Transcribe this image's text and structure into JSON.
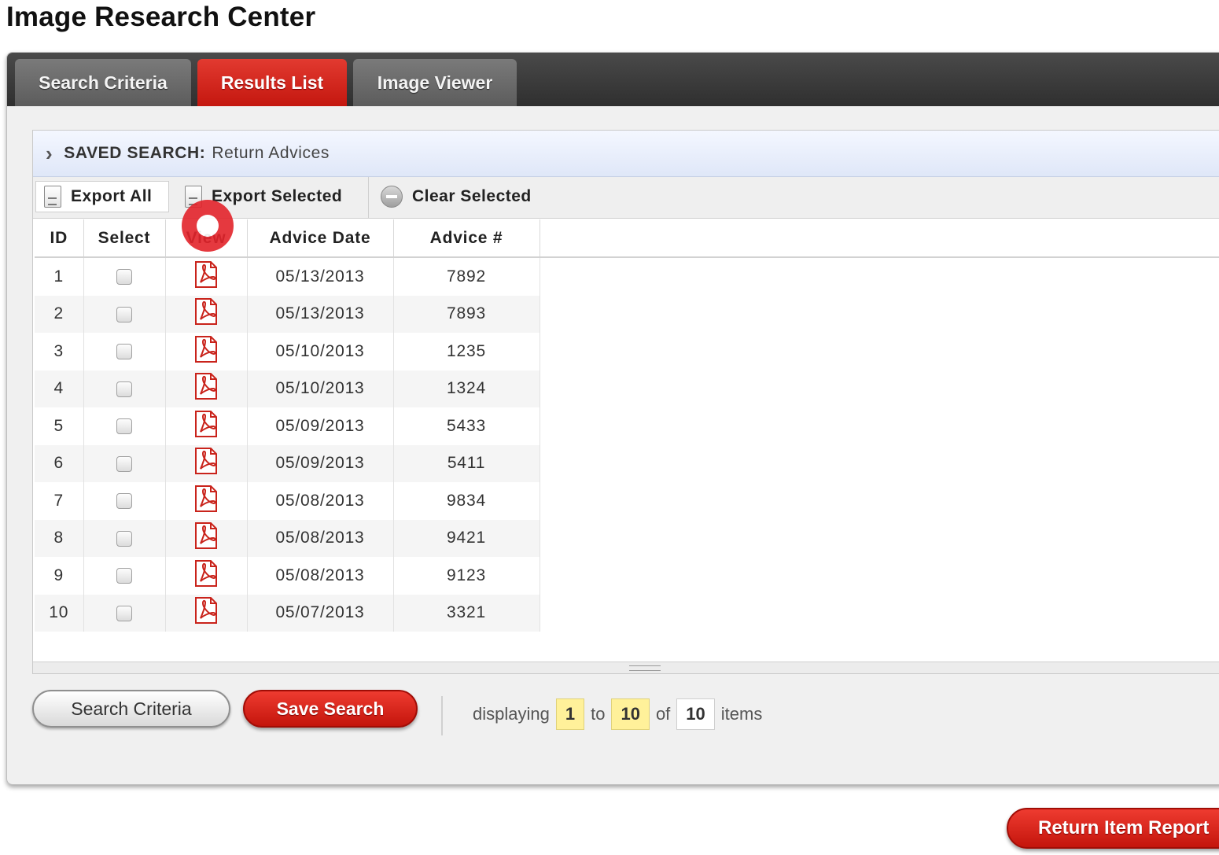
{
  "page_title": "Image Research Center",
  "tabs": [
    {
      "label": "Search Criteria",
      "active": false
    },
    {
      "label": "Results List",
      "active": true
    },
    {
      "label": "Image Viewer",
      "active": false
    }
  ],
  "saved_search": {
    "label": "SAVED SEARCH:",
    "value": "Return Advices"
  },
  "toolbar": {
    "export_all": "Export All",
    "export_selected": "Export Selected",
    "clear_selected": "Clear Selected"
  },
  "table": {
    "headers": {
      "id": "ID",
      "select": "Select",
      "view": "View",
      "advice_date": "Advice Date",
      "advice_no": "Advice #"
    },
    "rows": [
      {
        "id": "1",
        "date": "05/13/2013",
        "advice": "7892"
      },
      {
        "id": "2",
        "date": "05/13/2013",
        "advice": "7893"
      },
      {
        "id": "3",
        "date": "05/10/2013",
        "advice": "1235"
      },
      {
        "id": "4",
        "date": "05/10/2013",
        "advice": "1324"
      },
      {
        "id": "5",
        "date": "05/09/2013",
        "advice": "5433"
      },
      {
        "id": "6",
        "date": "05/09/2013",
        "advice": "5411"
      },
      {
        "id": "7",
        "date": "05/08/2013",
        "advice": "9834"
      },
      {
        "id": "8",
        "date": "05/08/2013",
        "advice": "9421"
      },
      {
        "id": "9",
        "date": "05/08/2013",
        "advice": "9123"
      },
      {
        "id": "10",
        "date": "05/07/2013",
        "advice": "3321"
      }
    ]
  },
  "footer": {
    "search_criteria_button": "Search Criteria",
    "save_search_button": "Save Search",
    "pager": {
      "displaying": "displaying",
      "from": "1",
      "to_word": "to",
      "to": "10",
      "of_word": "of",
      "total": "10",
      "items_word": "items"
    }
  },
  "return_button": "Return Item Report",
  "icons": {
    "doc": "document-icon",
    "minus": "minus-circle-icon",
    "pdf": "pdf-icon",
    "chevron": "chevron-right-icon"
  },
  "colors": {
    "accent_red": "#d42a20",
    "tab_bar": "#3a3a3a",
    "pager_highlight": "#fff19a",
    "saved_bar": "#e6ecfa"
  }
}
